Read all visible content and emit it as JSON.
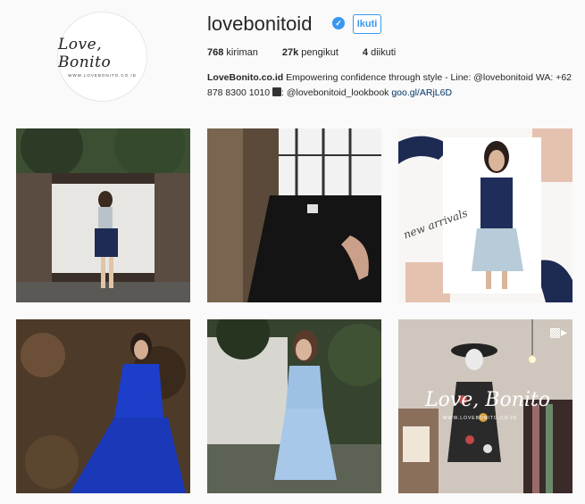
{
  "profile": {
    "username": "lovebonitoid",
    "follow_label": "Ikuti",
    "avatar_logo": "Love, Bonito",
    "avatar_url": "WWW.LOVEBONITO.CO.ID",
    "stats": [
      {
        "value": "768",
        "label": "kiriman"
      },
      {
        "value": "27k",
        "label": "pengikut"
      },
      {
        "value": "4",
        "label": "diikuti"
      }
    ],
    "bio": {
      "name": "LoveBonito.co.id",
      "text1": " Empowering confidence through style - Line: @lovebonitoid WA: +62 878 8300 1010 ",
      "text2": ": @lovebonitoid_lookbook ",
      "link": "goo.gl/ARjL6D"
    }
  },
  "posts": {
    "overlay_text": "new arrivals",
    "watermark": "Love, Bonito",
    "watermark_url": "WWW.LOVEBONITO.CO.ID"
  },
  "colors": {
    "accent": "#3897f0",
    "link": "#003569",
    "background": "#fafafa"
  }
}
